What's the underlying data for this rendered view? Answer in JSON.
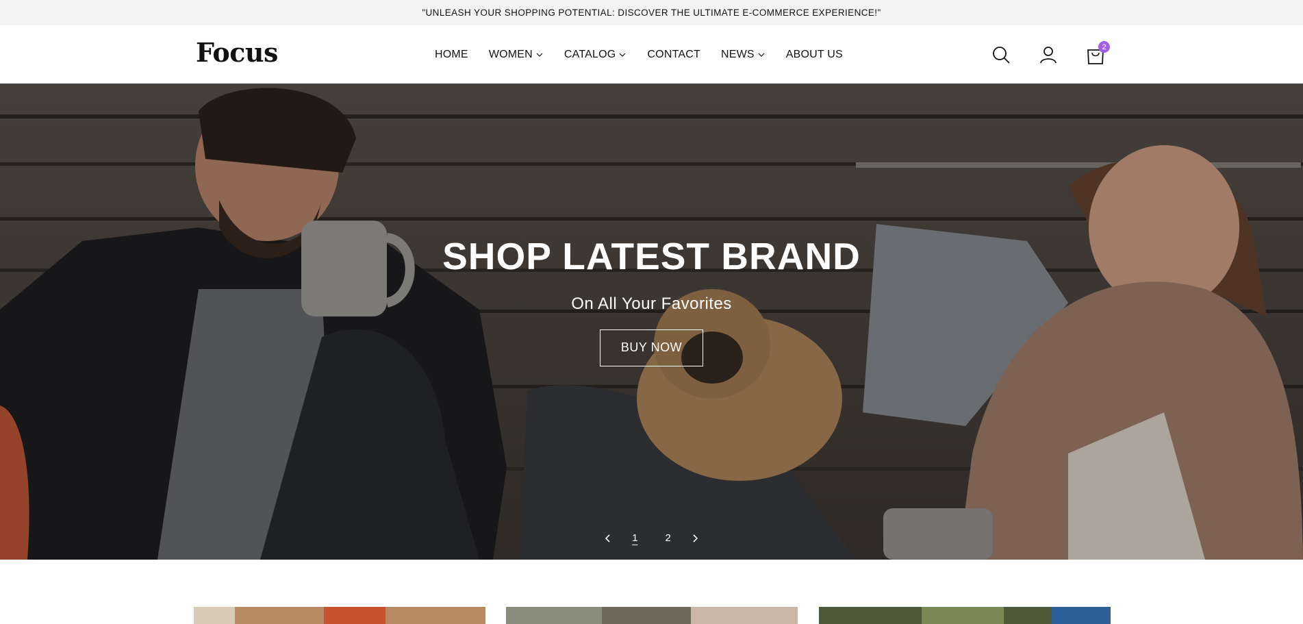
{
  "announcement": {
    "text": "\"UNLEASH YOUR SHOPPING POTENTIAL: DISCOVER THE ULTIMATE E-COMMERCE EXPERIENCE!\""
  },
  "header": {
    "logo": "Focus",
    "nav": [
      {
        "label": "HOME",
        "has_dropdown": false
      },
      {
        "label": "WOMEN",
        "has_dropdown": true
      },
      {
        "label": "CATALOG",
        "has_dropdown": true
      },
      {
        "label": "CONTACT",
        "has_dropdown": false
      },
      {
        "label": "NEWS",
        "has_dropdown": true
      },
      {
        "label": "ABOUT US",
        "has_dropdown": false
      }
    ],
    "icons": [
      "search-icon",
      "account-icon",
      "cart-icon"
    ],
    "cart_count": "2"
  },
  "hero": {
    "title": "SHOP LATEST BRAND",
    "subtitle": "On All Your Favorites",
    "button_label": "BUY NOW",
    "slides": [
      "1",
      "2"
    ],
    "active_slide": "1"
  },
  "colors": {
    "accent": "#a35ee6",
    "announcement_bg": "#f3f3f3"
  }
}
